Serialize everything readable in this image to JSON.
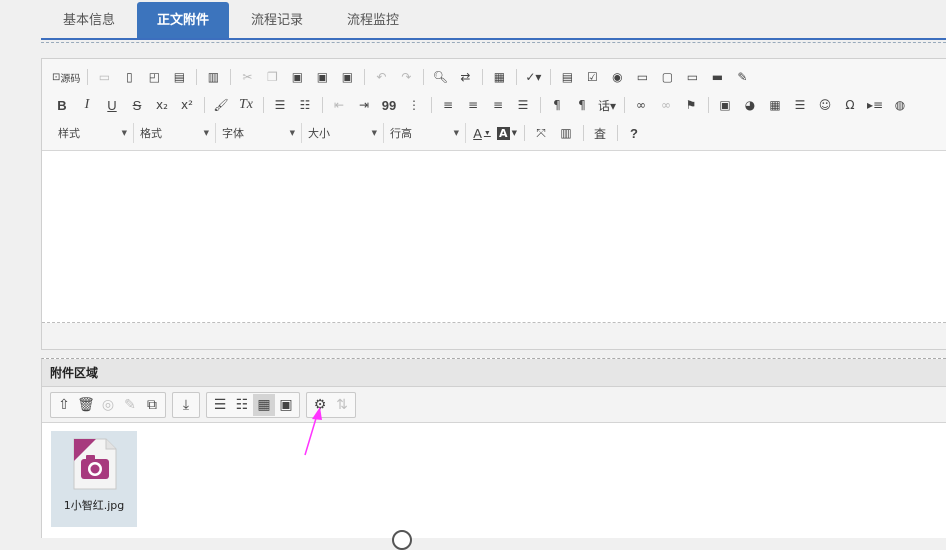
{
  "tabs": [
    {
      "label": "基本信息",
      "active": false
    },
    {
      "label": "正文附件",
      "active": true
    },
    {
      "label": "流程记录",
      "active": false
    },
    {
      "label": "流程监控",
      "active": false
    }
  ],
  "editor": {
    "toolbar": {
      "source_label": "源码",
      "bold": "B",
      "italic": "I",
      "underline": "U",
      "strike": "S",
      "subscript": "x₂",
      "superscript": "x²",
      "clear_format": "Tx",
      "quote": "99",
      "omega": "Ω",
      "help": "?",
      "dropdowns": [
        {
          "label": "样式"
        },
        {
          "label": "格式"
        },
        {
          "label": "字体"
        },
        {
          "label": "大小"
        },
        {
          "label": "行高"
        }
      ],
      "font_color": "A",
      "bg_color": "A"
    }
  },
  "attachments": {
    "header": "附件区域",
    "files": [
      {
        "name": "1小智红.jpg",
        "type": "jpeg",
        "icon": "camera-icon"
      }
    ]
  },
  "colors": {
    "tab_active": "#3c74bd",
    "annotation_arrow": "#ff33ff",
    "file_icon_accent": "#a73a7e"
  }
}
